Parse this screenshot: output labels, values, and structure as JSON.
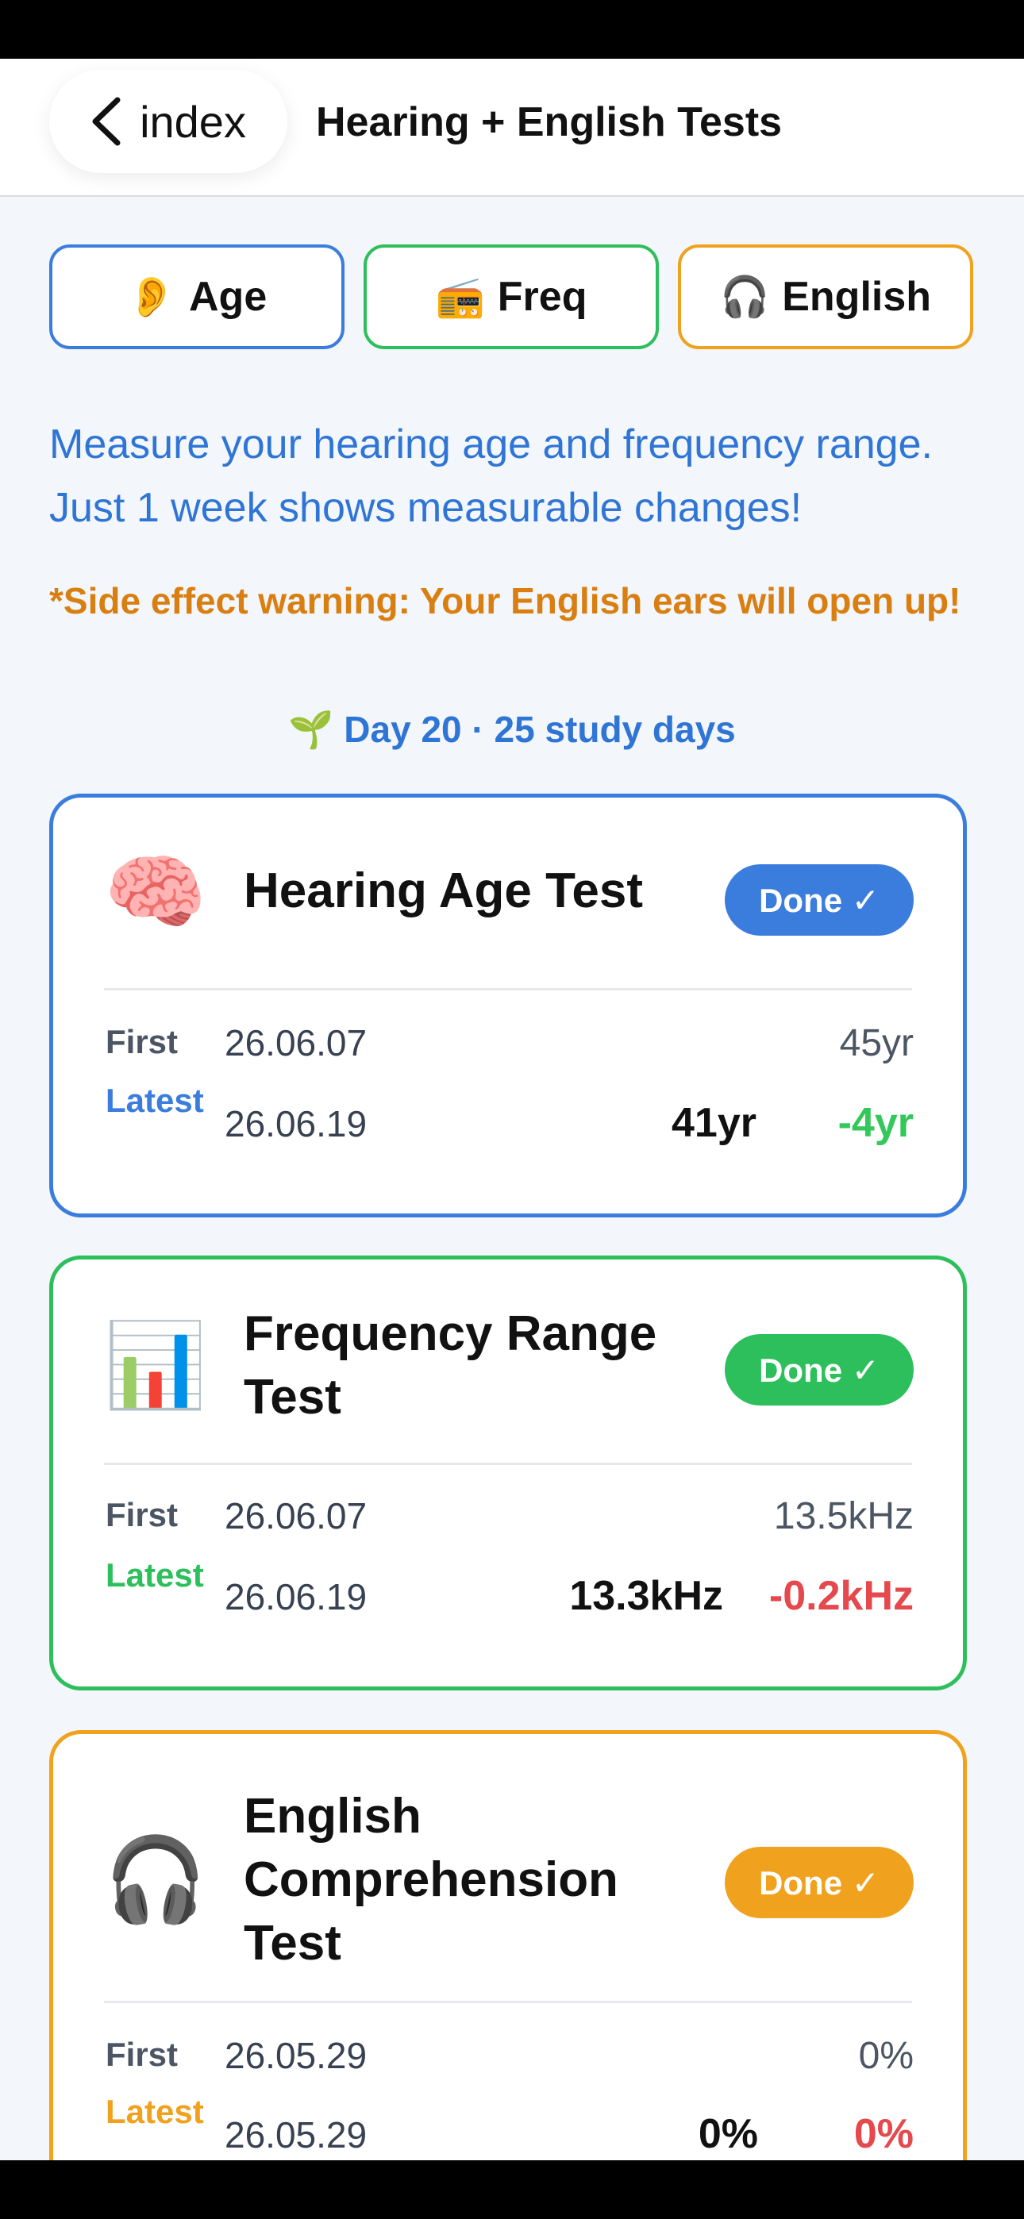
{
  "header": {
    "back_label": "index",
    "title": "Hearing + English Tests"
  },
  "tabs": [
    {
      "emoji": "👂",
      "label": "Age",
      "color": "#3b7ddd"
    },
    {
      "emoji": "📻",
      "label": "Freq",
      "color": "#2cbf5b"
    },
    {
      "emoji": "🎧",
      "label": "English",
      "color": "#f0a21e"
    }
  ],
  "intro": "Measure your hearing age and frequency range. Just 1 week shows measurable changes!",
  "warning": "*Side effect warning: Your English ears will open up!",
  "streak": {
    "emoji": "🌱",
    "text": "Day 20 · 25 study days"
  },
  "cards": [
    {
      "icon": "🧠",
      "title": "Hearing Age Test",
      "badge": "Done ✓",
      "color": "#3b7ddd",
      "first_label": "First",
      "first_date": "26.06.07",
      "first_value": "45yr",
      "latest_label": "Latest",
      "latest_date": "26.06.19",
      "latest_value": "41yr",
      "delta": "-4yr",
      "delta_color": "#34c759"
    },
    {
      "icon": "📊",
      "title": "Frequency Range Test",
      "badge": "Done ✓",
      "color": "#2cbf5b",
      "first_label": "First",
      "first_date": "26.06.07",
      "first_value": "13.5kHz",
      "latest_label": "Latest",
      "latest_date": "26.06.19",
      "latest_value": "13.3kHz",
      "delta": "-0.2kHz",
      "delta_color": "#e5484d"
    },
    {
      "icon": "🎧",
      "title": "English Comprehension Test",
      "badge": "Done ✓",
      "color": "#f0a21e",
      "first_label": "First",
      "first_date": "26.05.29",
      "first_value": "0%",
      "latest_label": "Latest",
      "latest_date": "26.05.29",
      "latest_value": "0%",
      "delta": "0%",
      "delta_color": "#e5484d"
    }
  ]
}
